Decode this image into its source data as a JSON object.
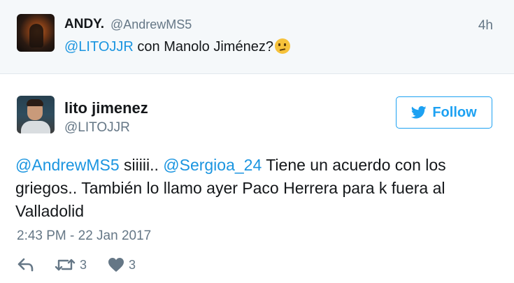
{
  "reply_context": {
    "name": "ANDY.",
    "handle": "@AndrewMS5",
    "time": "4h",
    "mention": "@LITOJJR",
    "text": " con Manolo Jiménez?",
    "emoji": "thinking-face-emoji"
  },
  "tweet": {
    "author_name": "lito jimenez",
    "author_handle": "@LITOJJR",
    "follow_label": "Follow",
    "text_parts": [
      {
        "type": "mention",
        "text": "@AndrewMS5"
      },
      {
        "type": "text",
        "text": " siiiii.. "
      },
      {
        "type": "mention",
        "text": "@Sergioa_24"
      },
      {
        "type": "text",
        "text": " Tiene un acuerdo con los griegos.. También lo llamo ayer Paco Herrera para k fuera al Valladolid"
      }
    ],
    "timestamp": "2:43 PM - 22 Jan 2017"
  },
  "actions": {
    "reply_icon": "reply-icon",
    "retweet_icon": "retweet-icon",
    "retweet_count": "3",
    "like_icon": "heart-icon",
    "like_count": "3"
  },
  "colors": {
    "link": "#1b95e0",
    "accent": "#1da1f2",
    "muted": "#657786",
    "context_bg": "#f5f8fa"
  }
}
